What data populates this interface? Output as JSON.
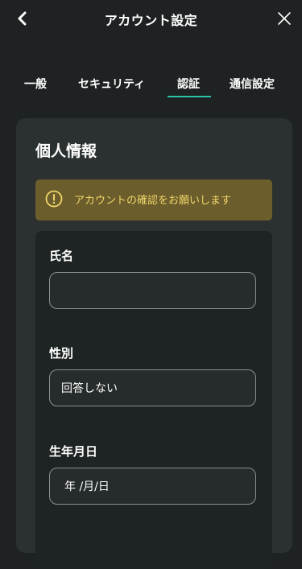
{
  "header": {
    "title": "アカウント設定",
    "back_icon": "chevron-left-icon",
    "close_icon": "close-icon"
  },
  "tabs": [
    {
      "label": "一般",
      "active": false
    },
    {
      "label": "セキュリティ",
      "active": false
    },
    {
      "label": "認証",
      "active": true
    },
    {
      "label": "通信設定",
      "active": false
    }
  ],
  "section": {
    "title": "個人情報",
    "alert": {
      "icon": "exclamation-circle-icon",
      "text": "アカウントの確認をお願いします"
    }
  },
  "form": {
    "name": {
      "label": "氏名",
      "value": ""
    },
    "gender": {
      "label": "性別",
      "value": "回答しない"
    },
    "birthdate": {
      "label": "生年月日",
      "placeholder": "年 /月/日"
    }
  },
  "colors": {
    "background": "#1e2222",
    "card": "#2b3131",
    "accent": "#2ac4a9",
    "alert_bg": "#6b5d2c",
    "alert_text": "#f0d66a"
  }
}
